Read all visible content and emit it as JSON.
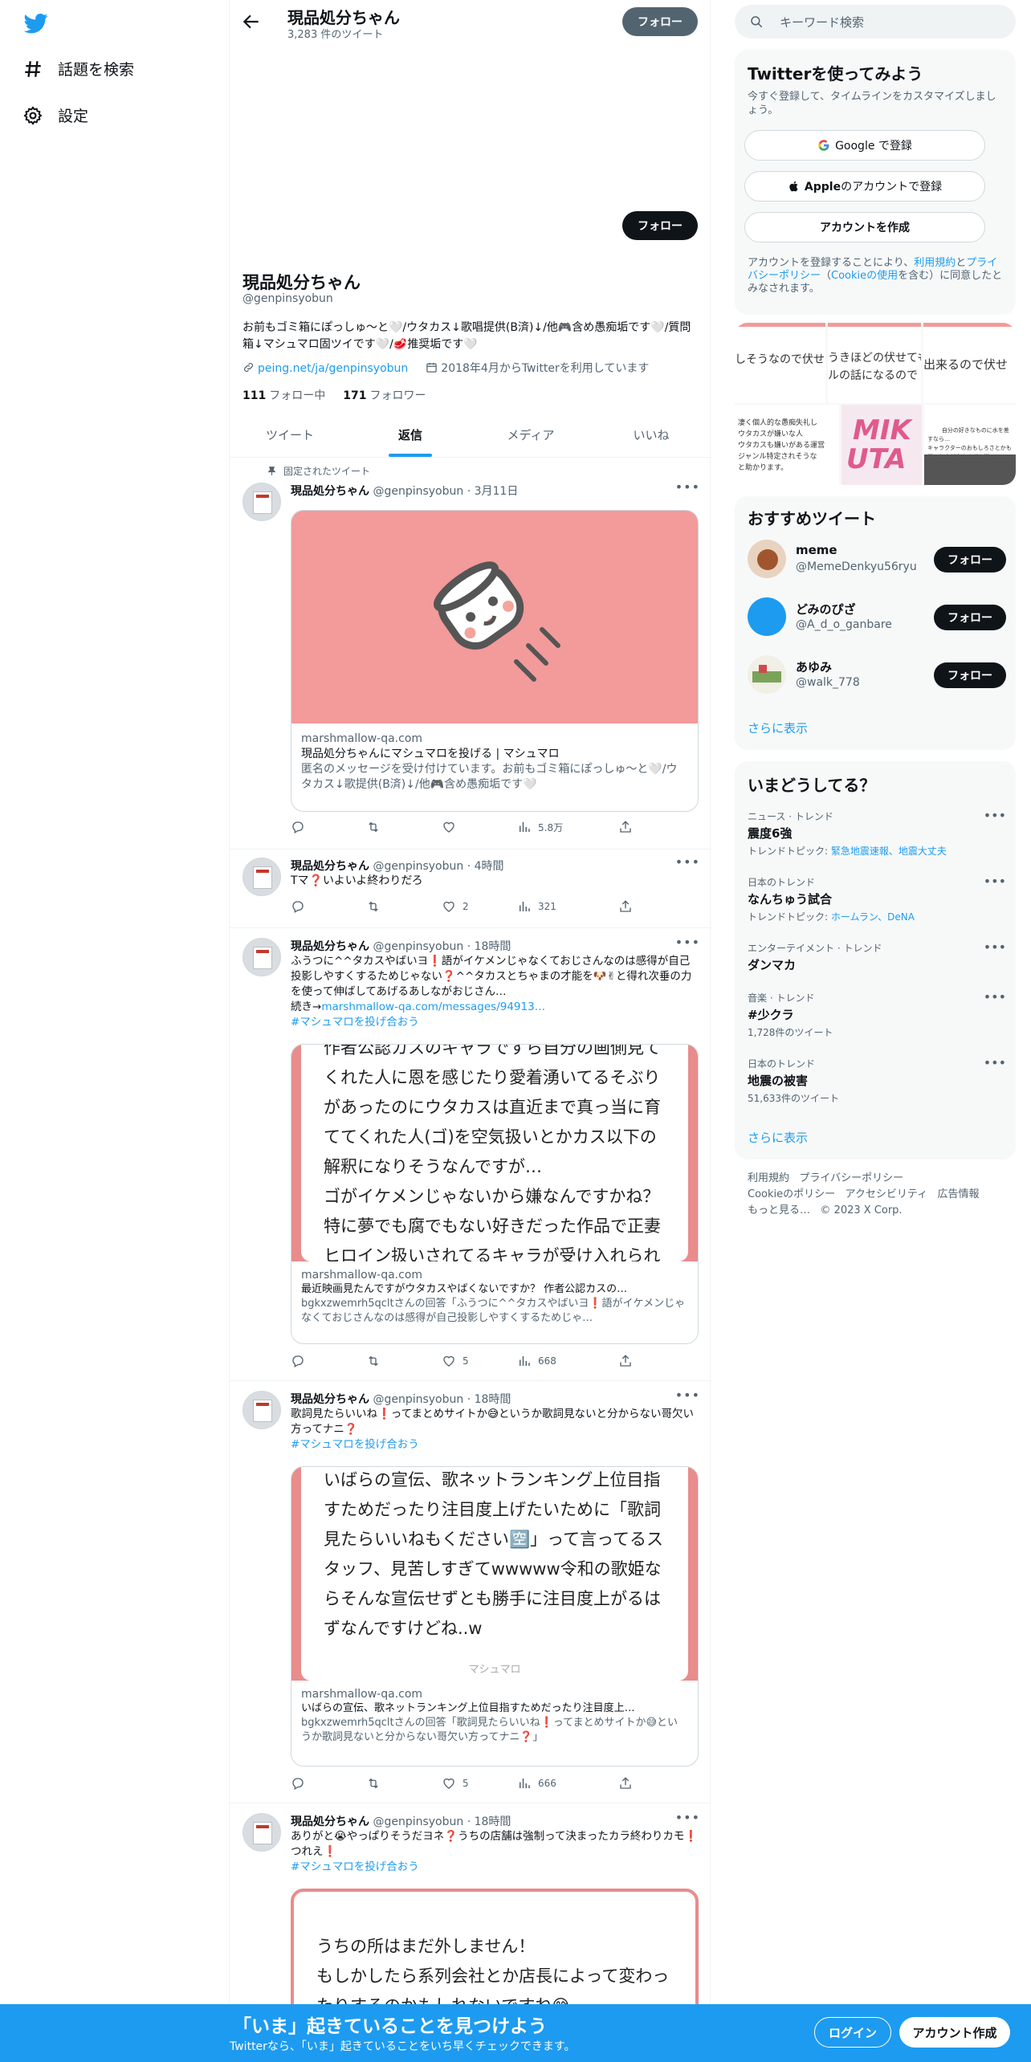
{
  "nav": {
    "explore_label": "話題を検索",
    "settings_label": "設定"
  },
  "header": {
    "name": "現品処分ちゃん",
    "tweet_count": "3,283 件のツイート",
    "follow_label": "フォロー"
  },
  "profile": {
    "follow_label": "フォロー",
    "name": "現品処分ちゃん",
    "handle": "@genpinsyobun",
    "bio": "お前もゴミ箱にぽっしゅ〜と🤍/ウタカス↓歌唱提供(B済)↓/他🎮含め愚痴垢です🤍/質問箱↓マシュマロ固ツイです🤍/🥩推奨垢です🤍",
    "link": "peing.net/ja/genpinsyobun",
    "joined": "2018年4月からTwitterを利用しています",
    "following_count": "111",
    "following_label": "フォロー中",
    "followers_count": "171",
    "followers_label": "フォロワー"
  },
  "tabs": [
    "ツイート",
    "返信",
    "メディア",
    "いいね"
  ],
  "tweets": [
    {
      "pinned_label": "固定されたツイート",
      "name": "現品処分ちゃん",
      "meta": "@genpinsyobun · 3月11日",
      "card_domain": "marshmallow-qa.com",
      "card_title": "現品処分ちゃんにマシュマロを投げる | マシュマロ",
      "card_desc": "匿名のメッセージを受け付けています。お前もゴミ箱にぽっしゅ〜と🤍/ウタカス↓歌提供(B済)↓/他🎮含め愚痴垢です🤍",
      "views": "5.8万"
    },
    {
      "name": "現品処分ちゃん",
      "meta": "@genpinsyobun · 4時間",
      "text": "Tマ❓いよいよ終わりだろ",
      "likes": "2",
      "views": "321"
    },
    {
      "name": "現品処分ちゃん",
      "meta": "@genpinsyobun · 18時間",
      "text": "ふうつに^^タカスやばいヨ❗語がイケメンじゃなくておじさんなのは感得が自己投影しやすくするためじゃない❓^^タカスとちゃまの才能を🐶✌と得れ次垂の力を使って伸ばしてあげるあしながおじさん…",
      "continue_label": "続き→",
      "link": "marshmallow-qa.com/messages/94913…",
      "hashtag": "#マシュマロを投げ合おう",
      "quote": "作者公認カスのキャラですら自分の画側見てくれた人に恩を感じたり愛着湧いてるそぶりがあったのにウタカスは直近まで真っ当に育ててくれた人(ゴ)を空気扱いとかカス以下の解釈になりそうなんですが…\nゴがイケメンじゃないから嫌なんですかね？\n特に夢でも腐でもない好きだった作品で正妻ヒロイン扱いされてるキャラが受け入れられない",
      "card_domain": "marshmallow-qa.com",
      "card_title": "最近映画見たんですがウタカスやばくないですか？ 作者公認カスの…",
      "card_desc": "bgkxzwemrh5qcltさんの回答「ふうつに^^タカスやばいヨ❗語がイケメンじゃなくておじさんなのは感得が自己投影しやすくするためじゃ…",
      "likes": "5",
      "views": "668"
    },
    {
      "name": "現品処分ちゃん",
      "meta": "@genpinsyobun · 18時間",
      "text": "歌詞見たらいいね❗ってまとめサイトか😅というか歌詞見ないと分からない哥欠い方ってナニ❓",
      "hashtag": "#マシュマロを投げ合おう",
      "quote": "いばらの宣伝、歌ネットランキング上位目指すためだったり注目度上げたいために「歌詞見たらいいねもください🈳」って言ってるスタッフ、見苦しすぎてwwwww令和の歌姫ならそんな宣伝せずとも勝手に注目度上がるはずなんですけどね..w",
      "quote_brand": "マシュマロ",
      "card_domain": "marshmallow-qa.com",
      "card_title": "いばらの宣伝、歌ネットランキング上位目指すためだったり注目度上…",
      "card_desc": "bgkxzwemrh5qcltさんの回答「歌詞見たらいいね❗ってまとめサイトか😅というか歌詞見ないと分からない哥欠い方ってナニ❓」",
      "likes": "5",
      "views": "666"
    },
    {
      "name": "現品処分ちゃん",
      "meta": "@genpinsyobun · 18時間",
      "text": "ありがと😭やっぱりそうだヨネ❓うちの店舗は強制って決まったカラ終わりカモ❗つれえ❗",
      "hashtag": "#マシュマロを投げ合おう",
      "quote": "うちの所はまだ外しません！\nもしかしたら系列会社とか店長によって変わったりするのかもしれないですね😅"
    }
  ],
  "right": {
    "search_placeholder": "キーワード検索",
    "signup": {
      "title": "Twitterを使ってみよう",
      "subtitle": "今すぐ登録して、タイムラインをカスタマイズしましょう。",
      "google": "Google で登録",
      "apple_bold": "Apple",
      "apple_rest": "のアカウントで登録",
      "create": "アカウントを作成",
      "legal_1": "アカウントを登録することにより、",
      "legal_terms": "利用規約",
      "legal_and": "と",
      "legal_privacy": "プライバシーポリシー",
      "legal_open": "（",
      "legal_cookie": "Cookieの使用",
      "legal_2": "を含む）に同意したとみなされます。"
    },
    "media_strip": {
      "t1": "しそうなので伏せ",
      "t2": "うきほどの伏せても",
      "t2b": "ルの話になるので",
      "t3": "出来るので伏せ",
      "t4": "凄く個人的な愚痴失礼し\nウタカスが嫌いな人\nウタカスも嫌いがある運営\nジャンル特定されそうな\nと助かります。",
      "t5a": "MIK",
      "t5b": "UTA",
      "t6": "自分の好きなものに水を差すなら…\nキャラクターのおもしろさとかも\n嫌いな人が大きすぎて嫌い"
    },
    "recommended": {
      "title": "おすすめツイート",
      "follow_label": "フォロー",
      "users": [
        {
          "name": "meme",
          "handle": "@MemeDenkyu56ryu"
        },
        {
          "name": "どみのぴざ",
          "handle": "@A_d_o_ganbare"
        },
        {
          "name": "あゆみ",
          "handle": "@walk_778"
        }
      ],
      "more": "さらに表示"
    },
    "trends": {
      "title": "いまどうしてる？",
      "items": [
        {
          "category": "ニュース · トレンド",
          "name": "震度6強",
          "sub_label": "トレンドトピック: ",
          "sub_links": "緊急地震速報、地震大丈夫"
        },
        {
          "category": "日本のトレンド",
          "name": "なんちゅう試合",
          "sub_label": "トレンドトピック: ",
          "sub_links": "ホームラン、DeNA"
        },
        {
          "category": "エンターテイメント · トレンド",
          "name": "ダンマカ"
        },
        {
          "category": "音楽 · トレンド",
          "name": "#少クラ",
          "sub_label": "1,728件のツイート"
        },
        {
          "category": "日本のトレンド",
          "name": "地震の被害",
          "sub_label": "51,633件のツイート"
        }
      ],
      "more": "さらに表示"
    },
    "footer": {
      "terms": "利用規約",
      "privacy": "プライバシーポリシー",
      "cookie": "Cookieのポリシー",
      "accessibility": "アクセシビリティ",
      "ads": "広告情報",
      "more": "もっと見る…",
      "copyright": "© 2023 X Corp."
    }
  },
  "banner": {
    "title": "「いま」起きていることを見つけよう",
    "subtitle": "Twitterなら、「いま」起きていることをいち早くチェックできます。",
    "login": "ログイン",
    "signup": "アカウント作成"
  },
  "colors": {
    "brand": "#1d9bf0",
    "card_pink": "#f39a9a",
    "text": "#0f1419",
    "secondary": "#536471"
  }
}
